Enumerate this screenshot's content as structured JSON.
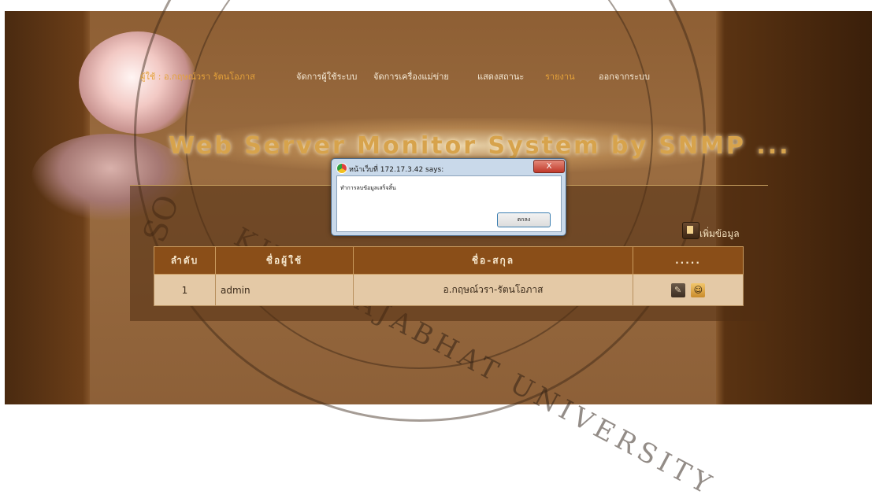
{
  "nav": {
    "user_greeting": "ผู้ใช้ : อ.กฤษณ์วรา รัตนโอภาส",
    "items": [
      "จัดการผู้ใช้ระบบ",
      "จัดการเครื่องแม่ข่าย",
      "แสดงสถานะ",
      "รายงาน",
      "ออกจากระบบ"
    ]
  },
  "title": "Web Server Monitor System by SNMP ...",
  "add_button": {
    "label": "เพิ่มข้อมูล",
    "icon": "document-add-icon"
  },
  "table": {
    "headers": [
      "ลำดับ",
      "ชื่อผู้ใช้",
      "ชื่อ-สกุล",
      "....."
    ],
    "rows": [
      {
        "no": "1",
        "username": "admin",
        "fullname": "อ.กฤษณ์วรา-รัตนโอภาส",
        "actions": [
          "edit-icon",
          "delete-icon"
        ]
      }
    ]
  },
  "dialog": {
    "title": "หน้าเว็บที่ 172.17.3.42 says:",
    "message": "ทำการลบข้อมูลเสร็จสิ้น",
    "ok_label": "ตกลง",
    "close_label": "X"
  },
  "watermark": {
    "top_text": "SO",
    "bottom_text": "KHLA RAJABHAT UNIVERSITY"
  },
  "colors": {
    "title": "#d7a34c",
    "nav_active": "#e5a23a",
    "nav_default": "#f5ead6",
    "table_header": "#8a4e18",
    "table_row": "#e4c9a6"
  }
}
